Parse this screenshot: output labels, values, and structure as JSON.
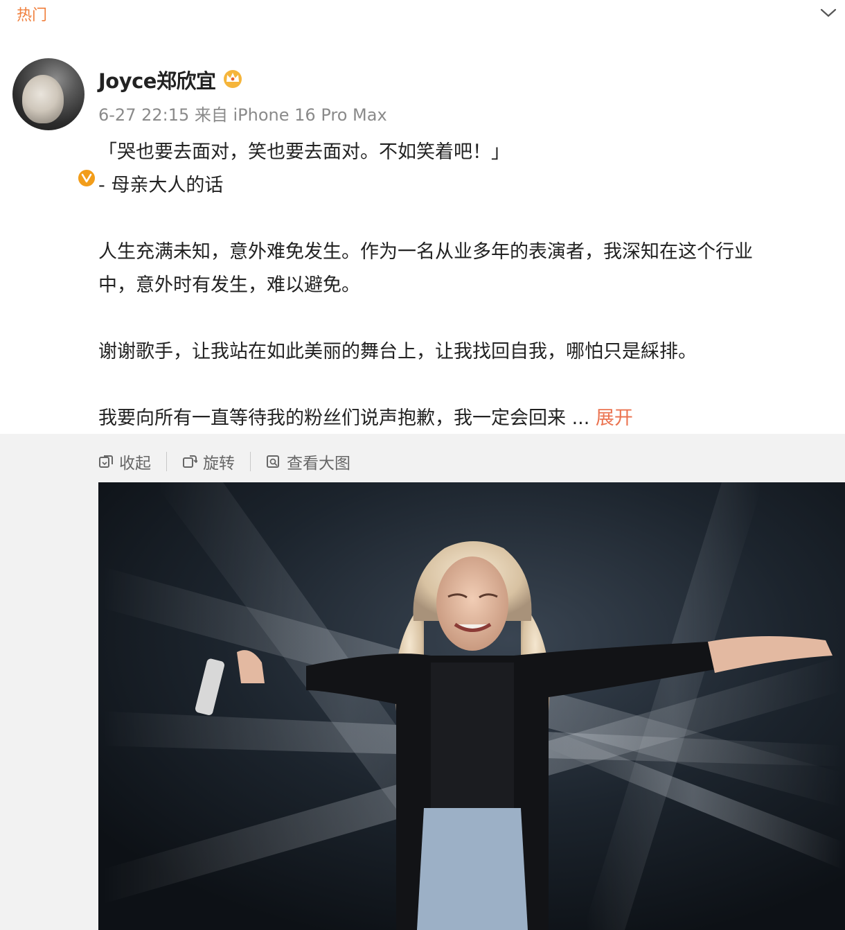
{
  "header": {
    "tab_label": "热门",
    "collapse_icon": "chevron-down-icon"
  },
  "post": {
    "author": "Joyce郑欣宜",
    "author_badge_icon": "crown-icon",
    "verified_icon": "verified-badge-icon",
    "meta": "6-27 22:15 来自 iPhone 16 Pro Max",
    "paragraphs": [
      "「哭也要去面对，笑也要去面对。不如笑着吧！」",
      "- 母亲大人的话",
      "人生充满未知，意外难免发生。作为一名从业多年的表演者，我深知在这个行业",
      "中，意外时有发生，难以避免。",
      "谢谢歌手，让我站在如此美丽的舞台上，让我找回自我，哪怕只是綵排。",
      "我要向所有一直等待我的粉丝们说声抱歉，我一定会回来"
    ],
    "ellipsis": " ... ",
    "expand_label": "展开"
  },
  "toolbar": {
    "collapse_label": "收起",
    "rotate_label": "旋转",
    "view_large_label": "查看大图"
  },
  "colors": {
    "accent": "#eb7350",
    "hot_label": "#f07f3c",
    "meta_text": "#8a8a8a",
    "toolbar_bg": "#f2f2f2"
  }
}
